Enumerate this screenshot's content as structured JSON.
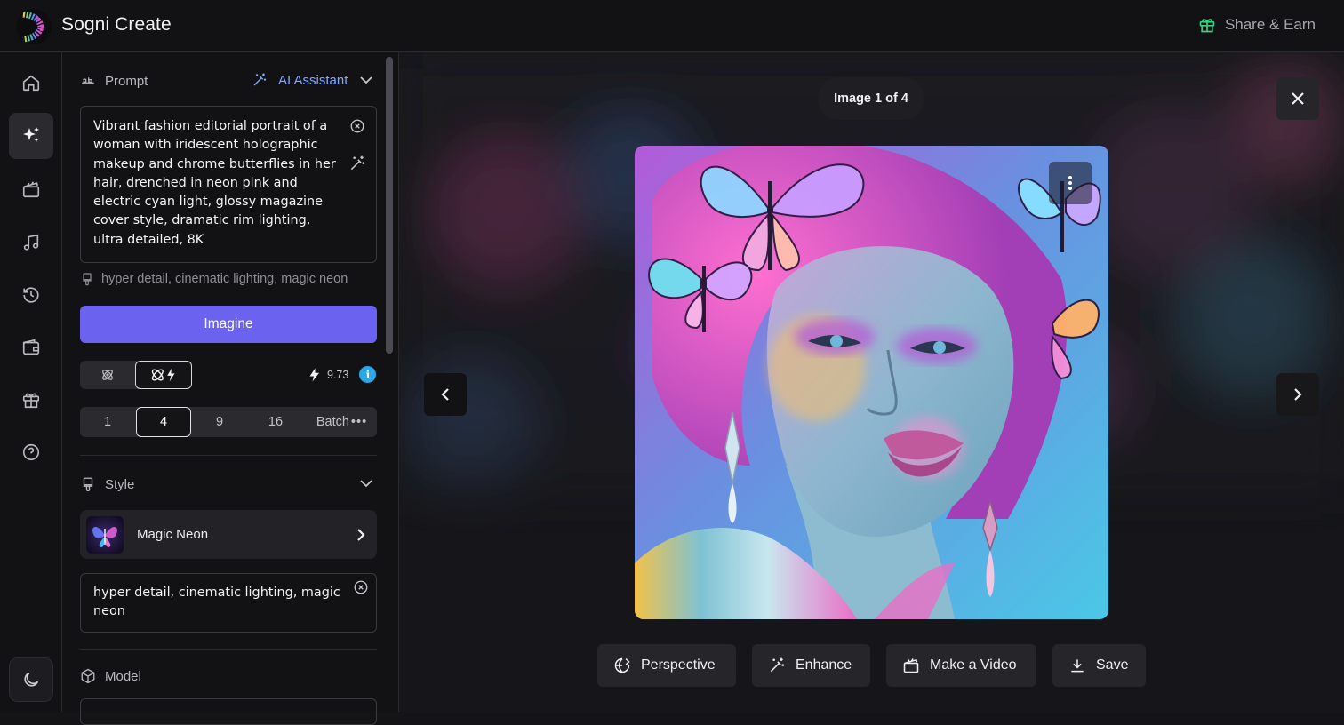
{
  "app": {
    "title": "Sogni Create",
    "share_label": "Share & Earn"
  },
  "rail": {
    "items": [
      "home-icon",
      "sparkle-icon",
      "clapperboard-icon",
      "music-note-icon",
      "history-icon",
      "wallet-icon",
      "gift-icon",
      "help-icon"
    ],
    "active": "sparkle-icon",
    "theme_toggle": "moon-icon"
  },
  "prompt": {
    "header": "Prompt",
    "assistant_label": "AI Assistant",
    "text": "Vibrant fashion editorial portrait of a woman with iridescent holographic makeup and chrome butterflies in her hair, drenched in neon pink and electric cyan light, glossy magazine cover style, dramatic rim lighting, ultra detailed, 8K",
    "style_suffix": "hyper detail, cinematic lighting, magic neon"
  },
  "imagine_label": "Imagine",
  "mode": {
    "options": [
      "standard-mode-icon",
      "fast-mode-icon"
    ],
    "selected": "fast-mode-icon"
  },
  "credits": {
    "value": "9.73",
    "info": "i"
  },
  "image_count": {
    "options": [
      "1",
      "4",
      "9",
      "16",
      "Batch"
    ],
    "selected": "4",
    "more": "•••"
  },
  "style": {
    "header": "Style",
    "name": "Magic Neon",
    "prompt_text": "hyper detail, cinematic lighting, magic neon"
  },
  "model": {
    "header": "Model"
  },
  "viewer": {
    "counter": "Image 1 of 4",
    "actions": [
      {
        "label": "Perspective",
        "icon": "perspective-icon"
      },
      {
        "label": "Enhance",
        "icon": "magic-wand-icon"
      },
      {
        "label": "Make a Video",
        "icon": "clapperboard-icon"
      },
      {
        "label": "Save",
        "icon": "download-icon"
      }
    ]
  },
  "colors": {
    "accent": "#6b63ef",
    "info": "#2aa7e8",
    "share_icon": "#3ccf83",
    "assistant": "#7fa9ff"
  }
}
